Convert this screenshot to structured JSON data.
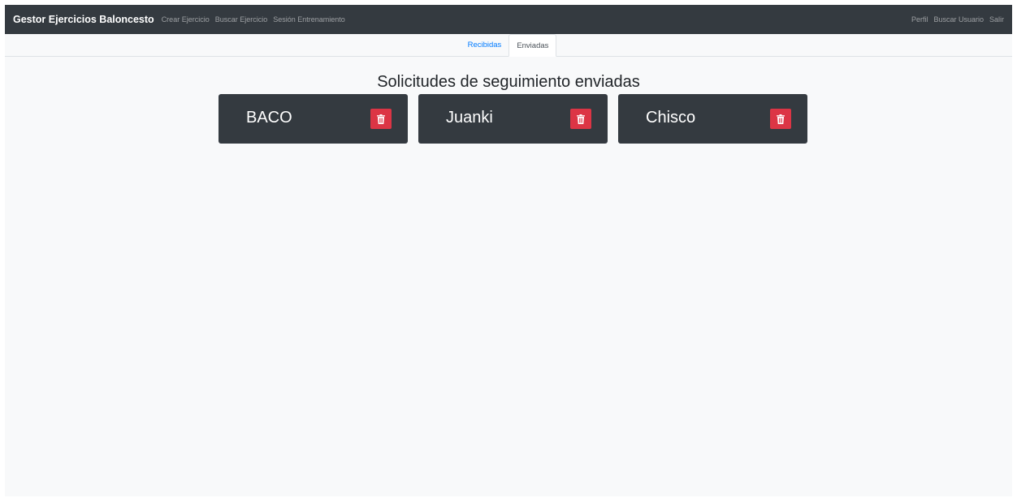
{
  "navbar": {
    "brand": "Gestor Ejercicios Baloncesto",
    "left_links": [
      "Crear Ejercicio",
      "Buscar Ejercicio",
      "Sesión Entrenamiento"
    ],
    "right_links": [
      "Perfil",
      "Buscar Usuario",
      "Salir"
    ]
  },
  "tabs": [
    {
      "label": "Recibidas",
      "active": false
    },
    {
      "label": "Enviadas",
      "active": true
    }
  ],
  "page": {
    "title": "Solicitudes de seguimiento enviadas"
  },
  "requests": [
    {
      "name": "BACO",
      "action_icon": "trash-icon"
    },
    {
      "name": "Juanki",
      "action_icon": "trash-icon"
    },
    {
      "name": "Chisco",
      "action_icon": "trash-icon"
    }
  ],
  "colors": {
    "navbar_bg": "#343a40",
    "card_bg": "#343a40",
    "delete_button": "#dc3545",
    "link_active_tab": "#007bff",
    "page_bg": "#f8f9fa"
  }
}
